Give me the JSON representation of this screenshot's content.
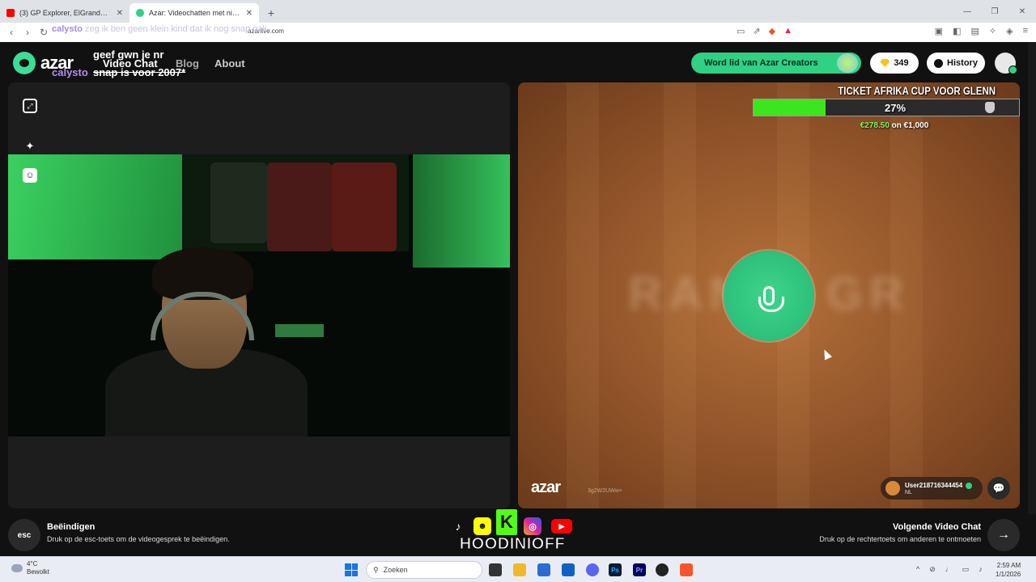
{
  "browser": {
    "tabs": [
      {
        "title": "(3) GP Explorer, ElGrandeToto, Zed, L",
        "active": false,
        "favicon_color": "#ff0000"
      },
      {
        "title": "Azar: Videochatten met nieu...",
        "active": true,
        "favicon_color": "#2fd182"
      }
    ],
    "new_tab": "+",
    "url": "azarlive.com",
    "window_controls": {
      "minimize": "—",
      "maximize": "❐",
      "close": "✕"
    }
  },
  "stream_overlay": {
    "chat_user": "calysto",
    "chat_message": "zeg ik ben geen klein kind dat ik nog snap pak,",
    "chat_line1": "geef gwn je nr",
    "chat_line2": "snap is voor 2007*",
    "chat_user2": "calysto"
  },
  "site": {
    "logo_text": "azar",
    "nav": {
      "video_chat": "Video Chat",
      "blog": "Blog",
      "about": "About"
    },
    "creators_button": "Word lid van Azar Creators",
    "coins": "349",
    "history_button": "History"
  },
  "right_panel": {
    "blurred_text": "RAN  E GR",
    "logo_text": "azar",
    "code": "3g2W2UWw+",
    "user": {
      "name": "User218716344454",
      "country": "NL"
    }
  },
  "ticket": {
    "title": "TICKET AFRIKA CUP VOOR GLENN",
    "percent_label": "27%",
    "progress": 0.27,
    "raised": "€278.50",
    "of_label": "on €1,000"
  },
  "bottom": {
    "esc_label": "esc",
    "end_title": "Beëindigen",
    "end_desc": "Druk op de esc-toets om de videogesprek te beëindigen.",
    "next_title": "Volgende Video Chat",
    "next_desc": "Druk op de rechtertoets om anderen te ontmoeten",
    "next_icon": "→",
    "handle": "HOODINIOFF"
  },
  "taskbar": {
    "weather_temp": "4°C",
    "weather_desc": "Bewolkt",
    "search_placeholder": "Zoeken",
    "time": "2:59 AM",
    "date": "1/1/2026"
  },
  "colors": {
    "accent": "#2fd182",
    "progress_fill": "#3ce61f",
    "right_bg": "#8f5228"
  }
}
